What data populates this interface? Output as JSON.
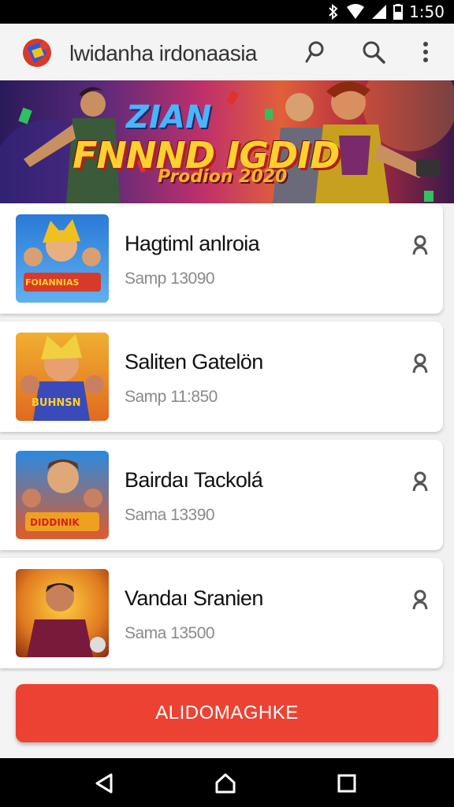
{
  "status_bar": {
    "time": "1:50"
  },
  "app_bar": {
    "title": "lwidanha irdonaasia"
  },
  "banner": {
    "line1": "ZIAN",
    "line2": "FNNND IGDID",
    "line3": "Prodion 2020"
  },
  "games": [
    {
      "title": "Hagtiml anlroia",
      "subtitle": "Samp 13090"
    },
    {
      "title": "Saliten Gatelön",
      "subtitle": "Samp 11:850"
    },
    {
      "title": "Bairdaı Tackolá",
      "subtitle": "Sama 13390"
    },
    {
      "title": "Vandaı Sranien",
      "subtitle": "Sama 13500"
    }
  ],
  "thumb_badges": [
    "FOIANNIAS",
    "BUHNSN",
    "DIDDINIK",
    ""
  ],
  "cta": {
    "label": "ALIDOMAGHKE"
  },
  "colors": {
    "accent": "#ec4233",
    "status_bar": "#000000",
    "nav_bar": "#000000"
  },
  "icons": {
    "app_bar": [
      "app-logo-icon",
      "pin-icon",
      "search-icon",
      "more-vert-icon"
    ],
    "card_action": "person-pin-icon",
    "nav": [
      "back-icon",
      "home-icon",
      "recents-icon"
    ]
  }
}
